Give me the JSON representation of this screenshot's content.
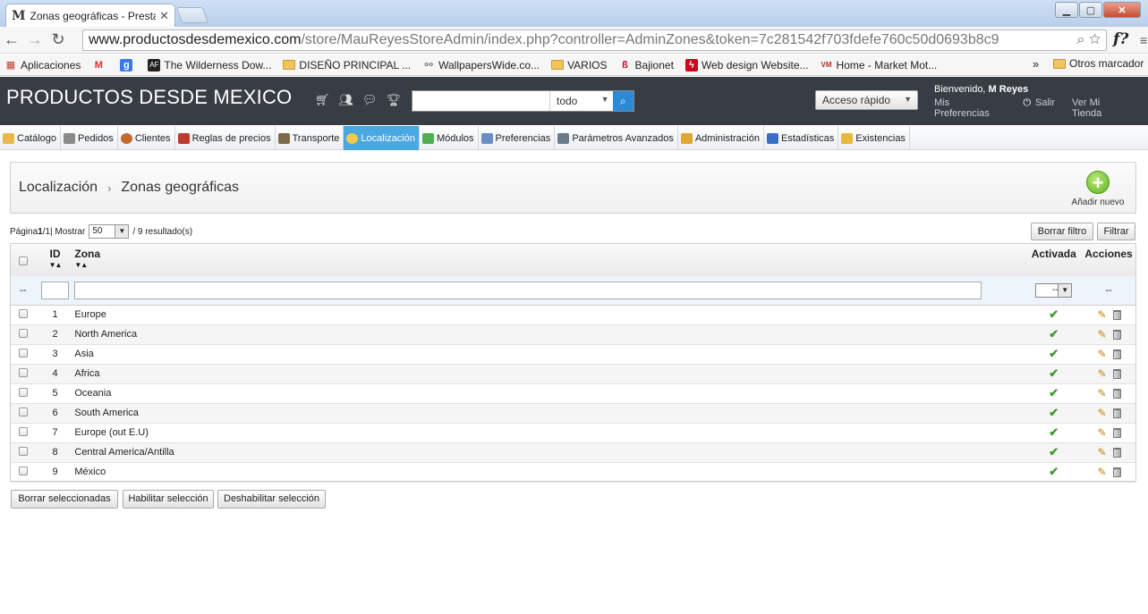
{
  "browser": {
    "tab_title": "Zonas geográficas - Presta",
    "tab_favicon": "M",
    "url_host": "www.productosdesdemexico.com",
    "url_path": "/store/MauReyesStoreAdmin/index.php?controller=AdminZones&token=7c281542f703fdefe760c50d0693b8c9",
    "extension_label": "f?"
  },
  "bookmarks": {
    "items": [
      {
        "label": "Aplicaciones",
        "icon": "apps-grid-icon"
      },
      {
        "label": "",
        "icon": "gmail-icon",
        "glyph": "M"
      },
      {
        "label": "",
        "icon": "google-icon",
        "glyph": "g"
      },
      {
        "label": "The Wilderness Dow...",
        "icon": "af-icon",
        "glyph": "AF"
      },
      {
        "label": "DISEÑO PRINCIPAL ...",
        "icon": "folder-icon"
      },
      {
        "label": "WallpapersWide.co...",
        "icon": "wallpaper-icon"
      },
      {
        "label": "VARIOS",
        "icon": "folder-icon"
      },
      {
        "label": "Bajionet",
        "icon": "bajionet-icon"
      },
      {
        "label": "Web design Website...",
        "icon": "webdesign-icon"
      },
      {
        "label": "Home - Market Mot...",
        "icon": "market-icon",
        "glyph": "VM"
      }
    ],
    "more": "»",
    "other": "Otros marcador"
  },
  "header": {
    "shop_name": "PRODUCTOS DESDE MEXICO",
    "search_placeholder": "",
    "search_scope": "todo",
    "quick_access": "Acceso rápido",
    "welcome_prefix": "Bienvenido, ",
    "welcome_user": "M Reyes",
    "preferences_link": "Mis Preferencias",
    "logout_link": "Salir",
    "view_store_link": "Ver Mi Tienda"
  },
  "menu": [
    {
      "label": "Catálogo",
      "icon": "folder-icon",
      "color": "#e9b84a"
    },
    {
      "label": "Pedidos",
      "icon": "cart-icon",
      "color": "#8a8a8a"
    },
    {
      "label": "Clientes",
      "icon": "customer-icon",
      "color": "#c46a2e"
    },
    {
      "label": "Reglas de precios",
      "icon": "price-rules-icon",
      "color": "#c0392b"
    },
    {
      "label": "Transporte",
      "icon": "truck-icon",
      "color": "#7a6b4a"
    },
    {
      "label": "Localización",
      "icon": "globe-icon",
      "color": "#f2c94c",
      "active": true
    },
    {
      "label": "Módulos",
      "icon": "puzzle-icon",
      "color": "#4caf50"
    },
    {
      "label": "Preferencias",
      "icon": "preferences-icon",
      "color": "#6a8fc7"
    },
    {
      "label": "Parámetros Avanzados",
      "icon": "wrench-icon",
      "color": "#6a7b8a"
    },
    {
      "label": "Administración",
      "icon": "key-icon",
      "color": "#e0a82e"
    },
    {
      "label": "Estadísticas",
      "icon": "chart-icon",
      "color": "#3a6fc4"
    },
    {
      "label": "Existencias",
      "icon": "stock-icon",
      "color": "#e8b93b"
    }
  ],
  "page": {
    "breadcrumb_parent": "Localización",
    "breadcrumb_separator": "›",
    "title": "Zonas geográficas",
    "add_new": "Añadir nuevo"
  },
  "pager": {
    "label_page": "Página ",
    "current_page": "1",
    "page_sep": " / ",
    "total_pages": "1",
    "label_show": " | Mostrar",
    "per_page": "50",
    "results": "/ 9 resultado(s)",
    "reset_filter": "Borrar filtro",
    "filter": "Filtrar"
  },
  "table": {
    "columns": {
      "id": "ID",
      "zone": "Zona",
      "active": "Activada",
      "actions": "Acciones"
    },
    "filter_placeholder_left": "--",
    "filter_active_value": "--",
    "filter_actions": "--",
    "rows": [
      {
        "id": "1",
        "zone": "Europe"
      },
      {
        "id": "2",
        "zone": "North America"
      },
      {
        "id": "3",
        "zone": "Asia"
      },
      {
        "id": "4",
        "zone": "Africa"
      },
      {
        "id": "5",
        "zone": "Oceania"
      },
      {
        "id": "6",
        "zone": "South America"
      },
      {
        "id": "7",
        "zone": "Europe (out E.U)"
      },
      {
        "id": "8",
        "zone": "Central America/Antilla"
      },
      {
        "id": "9",
        "zone": "México"
      }
    ]
  },
  "bulk": {
    "delete_selected": "Borrar seleccionadas",
    "enable_selected": "Habilitar selección",
    "disable_selected": "Deshabilitar selección"
  }
}
